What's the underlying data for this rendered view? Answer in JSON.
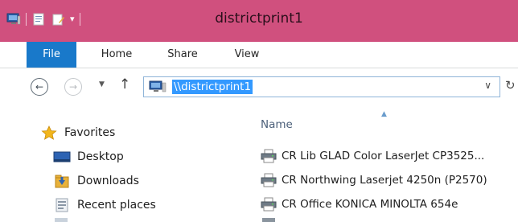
{
  "window": {
    "title": "districtprint1",
    "accent_color": "#d0507e"
  },
  "quick_access": {
    "icons": [
      "computer-icon",
      "properties-icon",
      "new-folder-icon",
      "customize-dropdown-icon"
    ]
  },
  "ribbon": {
    "tabs": [
      {
        "label": "File",
        "active": true
      },
      {
        "label": "Home"
      },
      {
        "label": "Share"
      },
      {
        "label": "View"
      }
    ]
  },
  "address_bar": {
    "path": "\\\\districtprint1",
    "icon": "network-computer-icon"
  },
  "navigation_pane": {
    "items": [
      {
        "label": "Favorites",
        "icon": "star-icon"
      },
      {
        "label": "Desktop",
        "icon": "desktop-icon"
      },
      {
        "label": "Downloads",
        "icon": "downloads-icon"
      },
      {
        "label": "Recent places",
        "icon": "recent-places-icon"
      }
    ]
  },
  "file_list": {
    "column_header": "Name",
    "sort": "ascending",
    "items": [
      {
        "name": "CR Lib GLAD Color LaserJet CP3525...",
        "icon": "printer-icon"
      },
      {
        "name": "CR Northwing Laserjet 4250n (P2570)",
        "icon": "printer-icon"
      },
      {
        "name": "CR Office KONICA MINOLTA 654e",
        "icon": "printer-icon"
      }
    ]
  }
}
